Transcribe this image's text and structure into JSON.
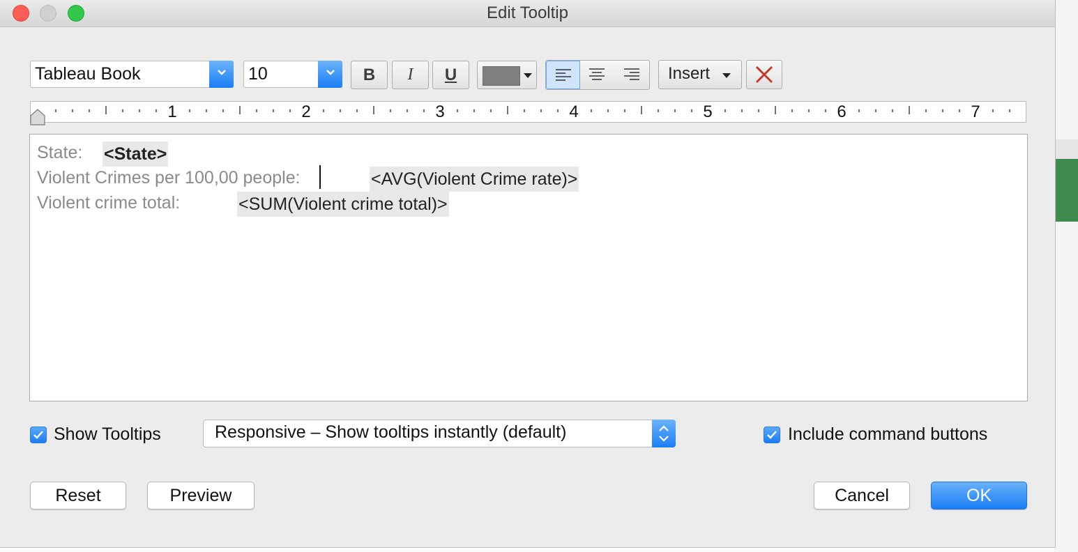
{
  "window": {
    "title": "Edit Tooltip"
  },
  "toolbar": {
    "font_family": "Tableau Book",
    "font_size": "10",
    "bold_label": "B",
    "italic_label": "I",
    "underline_label": "U",
    "text_color": "#7f7f7f",
    "insert_label": "Insert",
    "alignment": "left"
  },
  "ruler": {
    "numbers": [
      "1",
      "2",
      "3",
      "4",
      "5",
      "6",
      "7"
    ]
  },
  "editor": {
    "lines": [
      {
        "label": "State:",
        "field": "<State>"
      },
      {
        "label": "Violent Crimes per 100,00 people:",
        "field": "<AVG(Violent Crime rate)>"
      },
      {
        "label": "Violent crime total:",
        "field": "<SUM(Violent crime total)>"
      }
    ]
  },
  "options": {
    "show_tooltips_label": "Show Tooltips",
    "show_tooltips_checked": true,
    "tooltip_mode": "Responsive – Show tooltips instantly (default)",
    "include_buttons_label": "Include command buttons",
    "include_buttons_checked": true
  },
  "buttons": {
    "reset": "Reset",
    "preview": "Preview",
    "cancel": "Cancel",
    "ok": "OK"
  },
  "colors": {
    "accent": "#1a7ef5",
    "close": "#fc5f57",
    "maximize": "#34c84a",
    "clear_x": "#c0392b"
  }
}
